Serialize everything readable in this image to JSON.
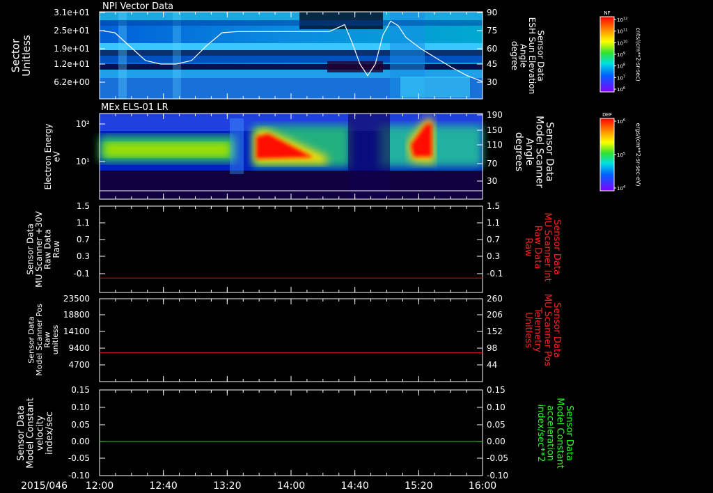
{
  "chart_data": [
    {
      "type": "heatmap",
      "title": "NPI Vector Data",
      "ylabel_left": [
        "Sector",
        "Unitless"
      ],
      "y_ticks_left": [
        "3.1e+01",
        "2.5e+01",
        "1.9e+01",
        "1.2e+01",
        "6.2e+00"
      ],
      "ylabel_right": [
        "Sensor Data",
        "ESH Sun Elevation",
        "Angle",
        "degree"
      ],
      "y_ticks_right": [
        90,
        75,
        60,
        45,
        30
      ],
      "ylim_right": [
        15,
        90
      ],
      "colorbar_label": "NF",
      "colorbar_ticks": [
        "10^12",
        "10^11",
        "10^10",
        "10^9",
        "10^8",
        "10^7",
        "10^6"
      ],
      "colorbar_unit": "cnts/(cm**2-sr-sec)",
      "overlay_line_color": "#ffffff",
      "overlay_line": {
        "x": [
          0,
          0.04,
          0.08,
          0.12,
          0.16,
          0.2,
          0.24,
          0.28,
          0.32,
          0.36,
          0.4,
          0.44,
          0.48,
          0.52,
          0.56,
          0.6,
          0.62,
          0.64,
          0.66,
          0.68,
          0.7,
          0.72,
          0.74,
          0.76,
          0.78,
          0.8,
          0.84,
          0.88,
          0.92,
          0.96,
          1
        ],
        "y": [
          74,
          72,
          60,
          48,
          45,
          45,
          48,
          61,
          72,
          73,
          73,
          73,
          73,
          73,
          73,
          73,
          76,
          79,
          63,
          45,
          35,
          45,
          70,
          82,
          78,
          68,
          58,
          50,
          42,
          35,
          30
        ]
      }
    },
    {
      "type": "heatmap",
      "title": "MEx ELS-01 LR",
      "ylabel_left": [
        "Electron Energy",
        "eV"
      ],
      "y_ticks_left": [
        "10²",
        "10¹"
      ],
      "ylabel_right": [
        "Sensor Data",
        "Model Scanner",
        "Angle",
        "degrees"
      ],
      "y_ticks_right": [
        190,
        150,
        110,
        70,
        30
      ],
      "colorbar_label": "DEF",
      "colorbar_ticks": [
        "10^6",
        "10^5",
        "10^4"
      ],
      "colorbar_unit": "ergs/(cm**2-sr-sec-eV)",
      "overlay_line_value": 5,
      "overlay_line_color": "#ffffff"
    },
    {
      "type": "line",
      "ylabel_left": [
        "Sensor Data",
        "MU Scanner +30V",
        "Raw Data",
        "Raw"
      ],
      "y_ticks_left": [
        "1.5",
        "1.1",
        "0.7",
        "0.3",
        "-0.1"
      ],
      "ylim_left": [
        -0.3,
        1.5
      ],
      "ylabel_right": [
        "Sensor Data",
        "MU Scanner Int",
        "Raw Data",
        "Raw"
      ],
      "y_ticks_right": [
        "1.5",
        "1.1",
        "0.7",
        "0.3",
        "-0.1"
      ],
      "right_label_color": "#ff2020",
      "series": [
        {
          "color": "#d01010",
          "value": 0.0
        }
      ]
    },
    {
      "type": "line",
      "ylabel_left": [
        "Sensor Data",
        "Model Scanner Pos",
        "Raw",
        "unitless"
      ],
      "y_ticks_left": [
        "23500",
        "18800",
        "14100",
        "9400",
        "4700"
      ],
      "ylim_left": [
        0,
        23500
      ],
      "ylabel_right": [
        "Sensor Data",
        "MU Scanner Pos",
        "Telemetry",
        "Unitless"
      ],
      "y_ticks_right": [
        "260",
        "206",
        "152",
        "98",
        "44"
      ],
      "right_label_color": "#ff2020",
      "series": [
        {
          "color": "#d01010",
          "value": 8200
        }
      ]
    },
    {
      "type": "line",
      "ylabel_left": [
        "Sensor Data",
        "Model Constant",
        "velocity",
        "index/sec"
      ],
      "y_ticks_left": [
        "0.15",
        "0.10",
        "0.05",
        "0.00",
        "-0.05",
        "-0.10"
      ],
      "ylim_left": [
        -0.1,
        0.15
      ],
      "ylabel_right": [
        "Sensor Data",
        "Model Constant",
        "acceleration",
        "index/sec**2"
      ],
      "y_ticks_right": [
        "0.15",
        "0.10",
        "0.05",
        "0.00",
        "-0.05",
        "-0.10"
      ],
      "right_label_color": "#20ff20",
      "series": [
        {
          "color": "#10c010",
          "value": 0.0
        }
      ]
    }
  ],
  "x_axis": {
    "date": "2015/046",
    "tick_labels": [
      "12:00",
      "12:40",
      "13:20",
      "14:00",
      "14:40",
      "15:20",
      "16:00"
    ]
  }
}
